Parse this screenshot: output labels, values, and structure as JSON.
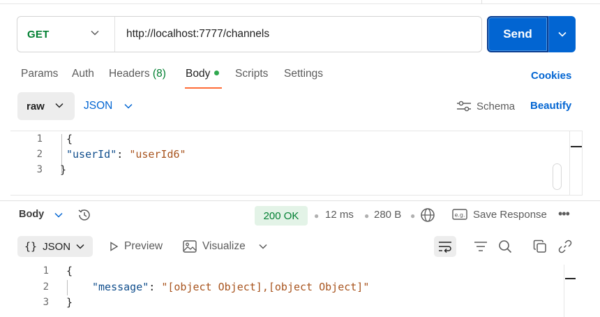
{
  "request": {
    "method": "GET",
    "url": "http://localhost:7777/channels",
    "send_label": "Send"
  },
  "tabs": [
    {
      "label": "Params"
    },
    {
      "label": "Auth"
    },
    {
      "label": "Headers",
      "count": "(8)"
    },
    {
      "label": "Body",
      "active": true
    },
    {
      "label": "Scripts"
    },
    {
      "label": "Settings"
    }
  ],
  "cookies_label": "Cookies",
  "body_options": {
    "mode": "raw",
    "language": "JSON",
    "schema_label": "Schema",
    "beautify_label": "Beautify"
  },
  "request_body": {
    "line_numbers": [
      "1",
      "2",
      "3"
    ],
    "open_brace": "{",
    "key": "\"userId\"",
    "colon": ": ",
    "value": "\"userId6\"",
    "close_brace": "}"
  },
  "response": {
    "section_label": "Body",
    "status": "200 OK",
    "time": "12 ms",
    "size": "280 B",
    "save_label": "Save Response",
    "format": "JSON",
    "preview_label": "Preview",
    "visualize_label": "Visualize",
    "line_numbers": [
      "1",
      "2",
      "3"
    ],
    "open_brace": "{",
    "key": "\"message\"",
    "colon": ": ",
    "value": "\"[object Object],[object Object]\"",
    "close_brace": "}"
  },
  "colors": {
    "accent_blue": "#0265d2",
    "method_green": "#007f31",
    "tab_underline": "#ff6c37",
    "status_bg": "#e3f3e7"
  }
}
